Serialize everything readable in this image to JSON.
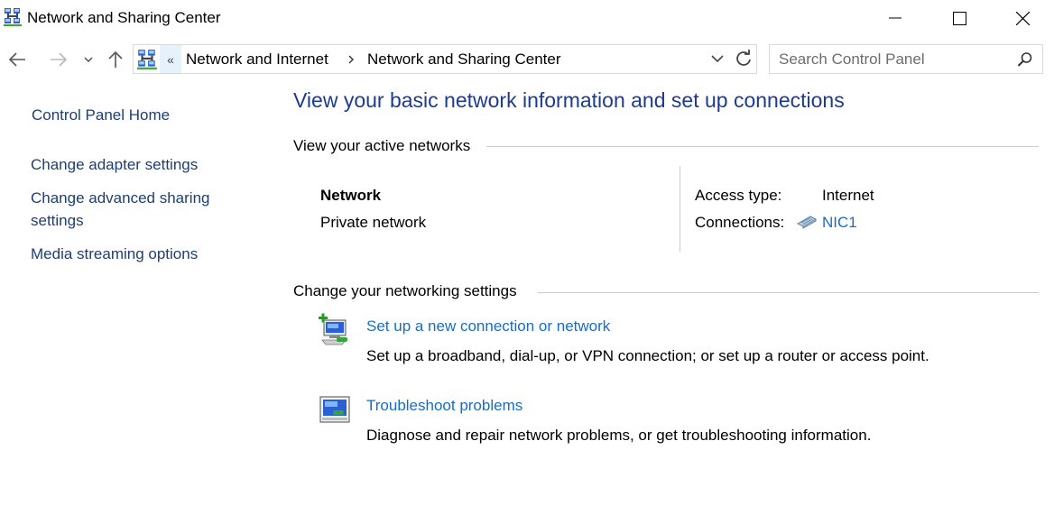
{
  "window": {
    "title": "Network and Sharing Center",
    "icon": "network-center-icon",
    "controls": [
      "minimize",
      "maximize",
      "close"
    ]
  },
  "nav": {
    "back": "back-arrow-icon",
    "forward": "forward-arrow-icon",
    "recent": "chevron-down-icon",
    "up": "up-arrow-icon"
  },
  "address": {
    "overflow": "«",
    "crumbs": [
      "Network and Internet",
      "Network and Sharing Center"
    ]
  },
  "search": {
    "placeholder": "Search Control Panel"
  },
  "sidebar": {
    "home": "Control Panel Home",
    "items": [
      {
        "label": "Change adapter settings"
      },
      {
        "label_line1": "Change advanced sharing",
        "label_line2": "settings"
      },
      {
        "label": "Media streaming options"
      }
    ]
  },
  "main": {
    "title": "View your basic network information and set up connections",
    "active_networks": {
      "heading": "View your active networks",
      "network_name": "Network",
      "network_type": "Private network",
      "access_type_label": "Access type:",
      "access_type_value": "Internet",
      "connections_label": "Connections:",
      "connections_value": "NIC1"
    },
    "change_settings": {
      "heading": "Change your networking settings",
      "tasks": [
        {
          "link": "Set up a new connection or network",
          "description": "Set up a broadband, dial-up, or VPN connection; or set up a router or access point."
        },
        {
          "link": "Troubleshoot problems",
          "description": "Diagnose and repair network problems, or get troubleshooting information."
        }
      ]
    }
  },
  "colors": {
    "link": "#1a6cc4",
    "title": "#1e3c8f",
    "sidebar_link": "#1f3f6e",
    "separator": "#cccccc"
  }
}
